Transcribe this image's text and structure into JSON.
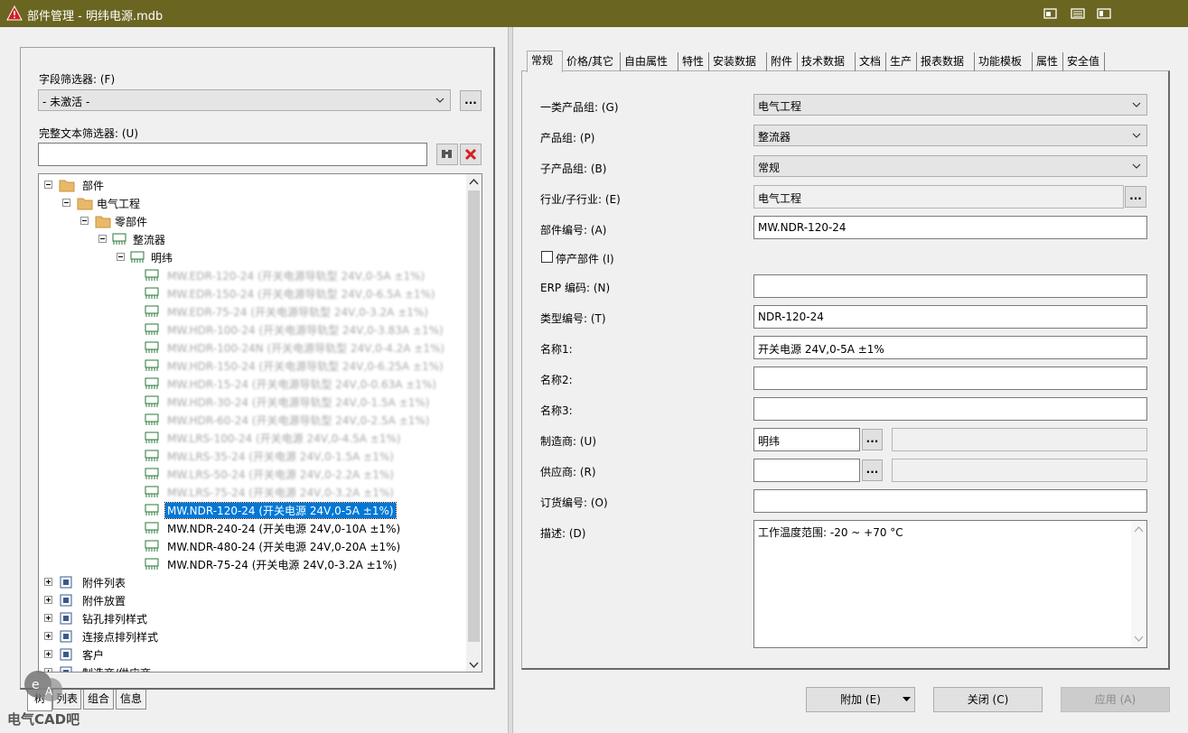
{
  "window": {
    "title": "部件管理 - 明纬电源.mdb",
    "accent": "#6b6522"
  },
  "left": {
    "field_filter_label": "字段筛选器: (F)",
    "field_filter_value": "- 未激活 -",
    "text_filter_label": "完整文本筛选器: (U)",
    "text_filter_value": "",
    "more_label": "...",
    "tree": {
      "root": "部件",
      "electrical": "电气工程",
      "components": "零部件",
      "rectifier": "整流器",
      "brand": "明纬",
      "parts": [
        "MW.EDR-120-24 (开关电源导轨型 24V,0-5A ±1%)",
        "MW.EDR-150-24 (开关电源导轨型 24V,0-6.5A ±1%)",
        "MW.EDR-75-24 (开关电源导轨型 24V,0-3.2A ±1%)",
        "MW.HDR-100-24 (开关电源导轨型 24V,0-3.83A ±1%)",
        "MW.HDR-100-24N (开关电源导轨型 24V,0-4.2A ±1%)",
        "MW.HDR-150-24 (开关电源导轨型 24V,0-6.25A ±1%)",
        "MW.HDR-15-24 (开关电源导轨型 24V,0-0.63A ±1%)",
        "MW.HDR-30-24 (开关电源导轨型 24V,0-1.5A ±1%)",
        "MW.HDR-60-24 (开关电源导轨型 24V,0-2.5A ±1%)",
        "MW.LRS-100-24 (开关电源 24V,0-4.5A ±1%)",
        "MW.LRS-35-24 (开关电源 24V,0-1.5A ±1%)",
        "MW.LRS-50-24 (开关电源 24V,0-2.2A ±1%)",
        "MW.LRS-75-24 (开关电源 24V,0-3.2A ±1%)",
        "MW.NDR-120-24 (开关电源 24V,0-5A ±1%)",
        "MW.NDR-240-24 (开关电源 24V,0-10A ±1%)",
        "MW.NDR-480-24 (开关电源 24V,0-20A ±1%)",
        "MW.NDR-75-24 (开关电源 24V,0-3.2A ±1%)"
      ],
      "groups": [
        "附件列表",
        "附件放置",
        "钻孔排列样式",
        "连接点排列样式",
        "客户",
        "制造商/供应商"
      ]
    },
    "bottom_tabs": [
      "树",
      "列表",
      "组合",
      "信息"
    ]
  },
  "tabs": [
    "常规",
    "价格/其它",
    "自由属性",
    "特性",
    "安装数据",
    "附件",
    "技术数据",
    "文档",
    "生产",
    "报表数据",
    "功能模板",
    "属性",
    "安全值"
  ],
  "form": {
    "product_group1_label": "一类产品组: (G)",
    "product_group1_value": "电气工程",
    "product_group_label": "产品组: (P)",
    "product_group_value": "整流器",
    "sub_group_label": "子产品组: (B)",
    "sub_group_value": "常规",
    "industry_label": "行业/子行业: (E)",
    "industry_value": "电气工程",
    "part_number_label": "部件编号: (A)",
    "part_number_value": "MW.NDR-120-24",
    "discontinued_label": "停产部件 (I)",
    "erp_label": "ERP 编码: (N)",
    "erp_value": "",
    "type_label": "类型编号: (T)",
    "type_value": "NDR-120-24",
    "name1_label": "名称1:",
    "name1_value": "开关电源 24V,0-5A ±1%",
    "name2_label": "名称2:",
    "name2_value": "",
    "name3_label": "名称3:",
    "name3_value": "",
    "manufacturer_label": "制造商: (U)",
    "manufacturer_value": "明纬",
    "supplier_label": "供应商: (R)",
    "supplier_value": "",
    "order_label": "订货编号: (O)",
    "order_value": "",
    "desc_label": "描述: (D)",
    "desc_value": "工作温度范围: -20 ~ +70 °C"
  },
  "buttons": {
    "add": "附加 (E)",
    "close": "关闭 (C)",
    "apply": "应用 (A)"
  },
  "watermark": "电气CAD吧"
}
